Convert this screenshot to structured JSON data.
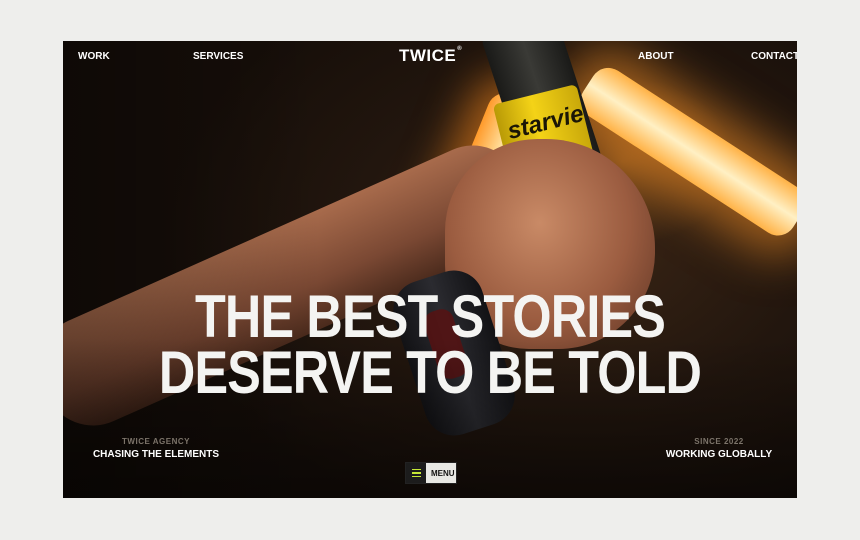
{
  "nav": {
    "items": [
      {
        "label": "WORK"
      },
      {
        "label": "SERVICES"
      },
      {
        "label": "ABOUT"
      },
      {
        "label": "CONTACT"
      }
    ],
    "logo": "TWICE",
    "logo_mark": "®"
  },
  "hero": {
    "line1": "THE BEST STORIES",
    "line2": "DESERVE TO BE TOLD"
  },
  "footer": {
    "left_kicker": "TWICE AGENCY",
    "left_text": "CHASING THE ELEMENTS",
    "right_kicker": "SINCE 2022",
    "right_text": "WORKING GLOBALLY",
    "menu_label": "MENU"
  },
  "photo": {
    "grip_text": "starvie"
  },
  "colors": {
    "accent": "#c6e836",
    "background": "#eeeeec",
    "text": "#ffffff"
  },
  "icons": {
    "menu": "hamburger-icon"
  }
}
